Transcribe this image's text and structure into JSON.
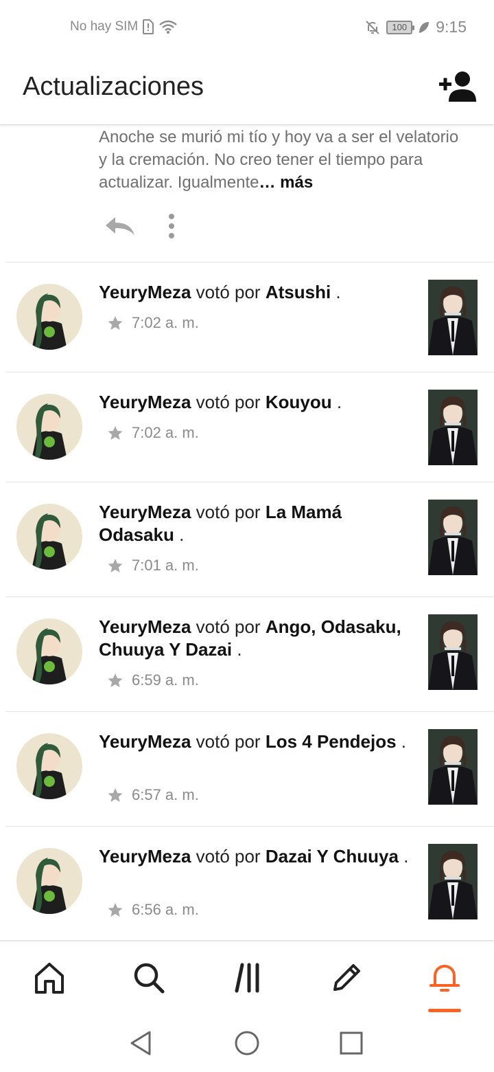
{
  "status_bar": {
    "carrier": "No hay SIM",
    "battery": "100",
    "time": "9:15",
    "icons": [
      "sim-icon",
      "wifi-icon",
      "bell-off-icon",
      "battery-icon",
      "leaf-icon"
    ]
  },
  "header": {
    "title": "Actualizaciones",
    "action_icon": "add-user-icon"
  },
  "truncated_post": {
    "text": "Anoche se murió mi tío y hoy va a ser el velatorio y la cremación. No creo tener el tiempo para actualizar.  Igualmente",
    "more": "… más",
    "icons": [
      "reply-icon",
      "more-vertical-icon"
    ]
  },
  "feed": {
    "items": [
      {
        "user": "YeuryMeza",
        "verb": "votó por",
        "title": "Atsushi",
        "end": ".",
        "time": "7:02 a. m."
      },
      {
        "user": "YeuryMeza",
        "verb": "votó por",
        "title": "Kouyou",
        "end": ".",
        "time": "7:02 a. m."
      },
      {
        "user": "YeuryMeza",
        "verb": "votó por",
        "title": "La Mamá Odasaku",
        "end": ".",
        "time": "7:01 a. m."
      },
      {
        "user": "YeuryMeza",
        "verb": "votó por",
        "title": "Ango, Odasaku, Chuuya Y Dazai",
        "end": ".",
        "time": "6:59 a. m."
      },
      {
        "user": "YeuryMeza",
        "verb": "votó por",
        "title": "Los 4 Pendejos",
        "end": ".",
        "time": "6:57 a. m."
      },
      {
        "user": "YeuryMeza",
        "verb": "votó por",
        "title": "Dazai Y Chuuya",
        "end": ".",
        "time": "6:56 a. m."
      }
    ]
  },
  "bottom_nav": {
    "items": [
      "home-icon",
      "search-icon",
      "library-icon",
      "write-icon",
      "notifications-icon"
    ],
    "active": "notifications-icon",
    "active_color": "#ff6122"
  },
  "system_nav": [
    "back-icon",
    "home-circle-icon",
    "recents-icon"
  ]
}
